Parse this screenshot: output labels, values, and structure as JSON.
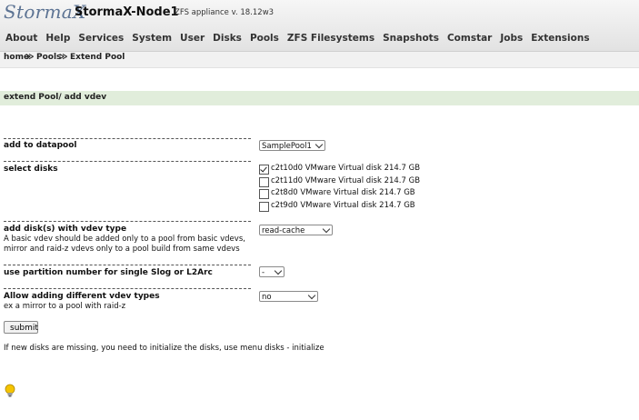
{
  "header": {
    "logo": "StormaX",
    "app_name": "StormaX-Node1",
    "version": "ZFS appliance v. 18.12w3"
  },
  "nav": [
    {
      "label": "About"
    },
    {
      "label": "Help"
    },
    {
      "label": "Services"
    },
    {
      "label": "System"
    },
    {
      "label": "User"
    },
    {
      "label": "Disks"
    },
    {
      "label": "Pools"
    },
    {
      "label": "ZFS Filesystems"
    },
    {
      "label": "Snapshots"
    },
    {
      "label": "Comstar"
    },
    {
      "label": "Jobs"
    },
    {
      "label": "Extensions"
    }
  ],
  "breadcrumb": {
    "items": [
      "home",
      "Pools",
      "Extend Pool"
    ],
    "separator": "≫"
  },
  "section": {
    "title": "extend Pool/ add vdev"
  },
  "form": {
    "datapool": {
      "label": "add to datapool",
      "value": "SamplePool1"
    },
    "disks": {
      "label": "select disks",
      "items": [
        {
          "label": "c2t10d0 VMware Virtual disk 214.7 GB",
          "checked": true
        },
        {
          "label": "c2t11d0 VMware Virtual disk 214.7 GB",
          "checked": false
        },
        {
          "label": "c2t8d0 VMware Virtual disk 214.7 GB",
          "checked": false
        },
        {
          "label": "c2t9d0 VMware Virtual disk 214.7 GB",
          "checked": false
        }
      ]
    },
    "vdev_type": {
      "label": "add disk(s) with vdev type",
      "desc1": "A basic vdev should be added only to a pool from basic vdevs,",
      "desc2": "mirror and raid-z vdevs only to a pool build from same vdevs",
      "value": "read-cache"
    },
    "partition": {
      "label": "use partition number for single Slog or L2Arc",
      "value": "-"
    },
    "allow_types": {
      "label": "Allow adding different vdev types",
      "desc": "ex a mirror to a pool with raid-z",
      "value": "no"
    },
    "submit_label": "submit"
  },
  "note": "If new disks are missing, you need to initialize the disks, use menu disks - initialize",
  "colors": {
    "logo": "#5c7393",
    "section_bar": "#e1eddb",
    "bulb": "#f5c400"
  }
}
